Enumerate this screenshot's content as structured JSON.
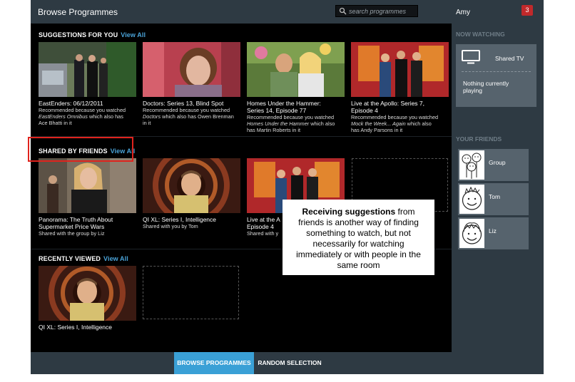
{
  "header": {
    "title": "Browse Programmes",
    "search_placeholder": "search programmes",
    "user_name": "Amy",
    "notification_count": "3"
  },
  "sections": {
    "suggestions": {
      "title": "SUGGESTIONS FOR YOU",
      "view_all": "View All",
      "cards": [
        {
          "title": "EastEnders: 06/12/2011",
          "meta_1": "Recommended because you watched",
          "meta_2_italic": "EastEnders Omnibus",
          "meta_2": " which also has",
          "meta_3": "Ace Bhatti in it"
        },
        {
          "title": "Doctors: Series 13, Blind Spot",
          "meta_1": "Recommended because you watched",
          "meta_2_italic": "Doctors",
          "meta_2": " which also has Owen Brenman",
          "meta_3": "in it"
        },
        {
          "title": "Homes Under the Hammer:",
          "title_2": "Series 14, Episode 77",
          "meta_1": "Recommended because you watched",
          "meta_2_italic": "Homes Under the Hammer",
          "meta_2": " which also",
          "meta_3": "has Martin Roberts in it"
        },
        {
          "title": "Live at the Apollo: Series 7,",
          "title_2": "Episode 4",
          "meta_1": "Recommended because you watched",
          "meta_2_italic": "Mock the Week... Again",
          "meta_2": " which also",
          "meta_3": "has Andy Parsons in it"
        }
      ]
    },
    "shared": {
      "title": "SHARED BY FRIENDS",
      "view_all": "View All",
      "cards": [
        {
          "title": "Panorama: The Truth About",
          "title_2": "Supermarket Price Wars",
          "meta_1": "Shared with the group by Liz"
        },
        {
          "title": "QI XL: Series I, Intelligence",
          "meta_1": "Shared with you by Tom"
        },
        {
          "title": "Live at the A",
          "title_2": "Episode 4",
          "meta_1": "Shared with y"
        }
      ]
    },
    "recent": {
      "title": "RECENTLY VIEWED",
      "view_all": "View All",
      "cards": [
        {
          "title": "QI XL: Series I, Intelligence"
        }
      ]
    }
  },
  "callout": {
    "bold": "Receiving suggestions",
    "text": " from friends is another way of finding something to watch, but not necessarily for watching immediately or with people in the same room"
  },
  "right_panel": {
    "now_watching_heading": "NOW WATCHING",
    "device_label": "Shared TV",
    "status": "Nothing currently playing",
    "friends_heading": "YOUR FRIENDS",
    "friends": [
      {
        "name": "Group"
      },
      {
        "name": "Tom"
      },
      {
        "name": "Liz"
      }
    ]
  },
  "bottom_tabs": [
    {
      "label": "BROWSE PROGRAMMES",
      "active": true
    },
    {
      "label": "RANDOM SELECTION",
      "active": false
    }
  ],
  "colors": {
    "app_bg": "#2e3a43",
    "accent_blue": "#3aa0d6",
    "link_blue": "#4aa3d8",
    "badge_red": "#c0292b",
    "highlight_red": "#e0231d"
  }
}
